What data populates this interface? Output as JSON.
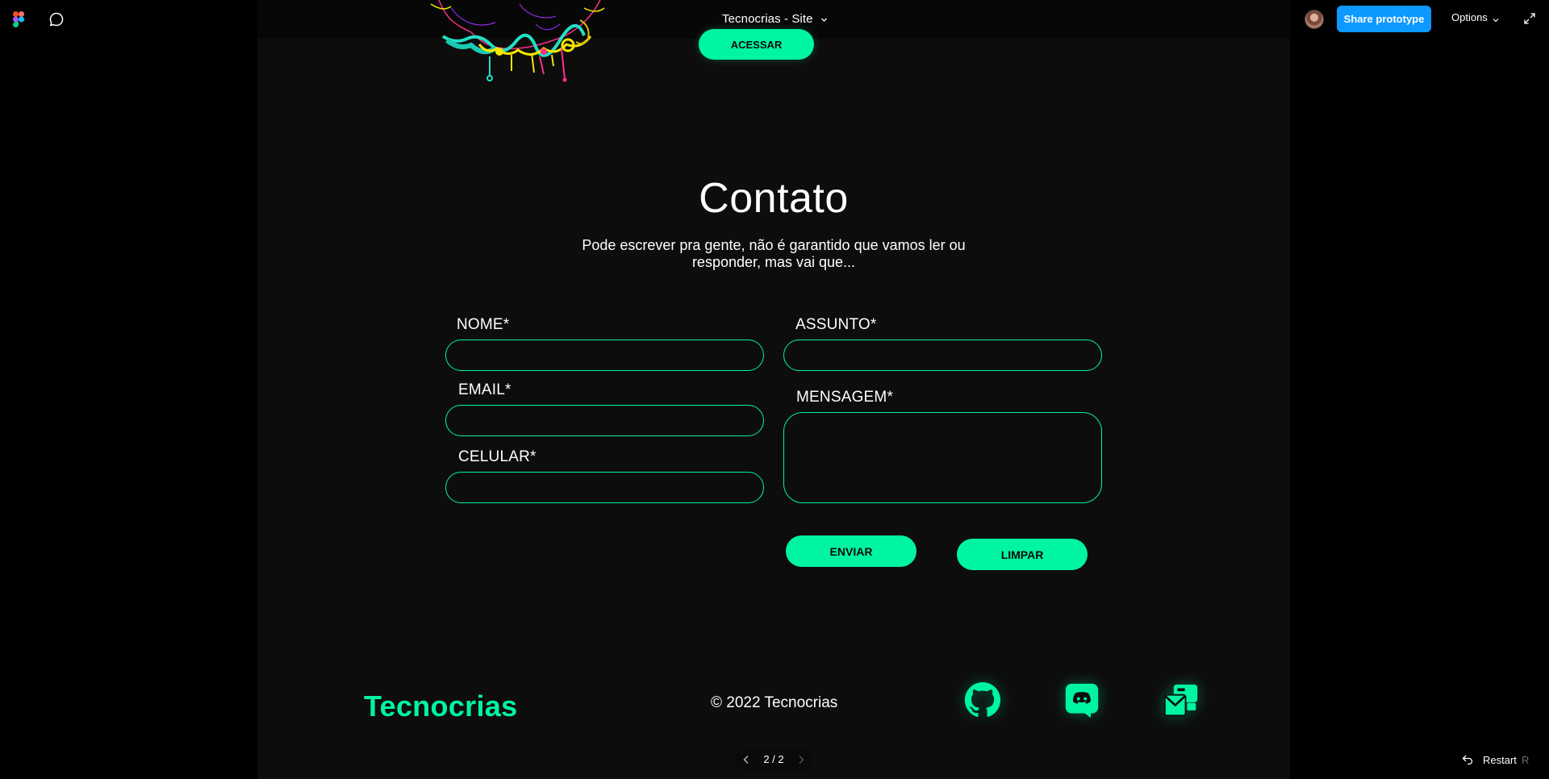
{
  "toolbar": {
    "title": "Tecnocrias - Site",
    "share_label": "Share prototype",
    "options_label": "Options"
  },
  "hero": {
    "acessar_label": "ACESSAR"
  },
  "contact": {
    "title": "Contato",
    "subtitle": "Pode escrever pra gente, não é garantido que vamos ler ou responder, mas vai que...",
    "fields": {
      "nome": {
        "label": "NOME*",
        "value": ""
      },
      "email": {
        "label": "EMAIL*",
        "value": ""
      },
      "celular": {
        "label": "CELULAR*",
        "value": ""
      },
      "assunto": {
        "label": "ASSUNTO*",
        "value": ""
      },
      "mensagem": {
        "label": "MENSAGEM*",
        "value": ""
      }
    },
    "send_label": "ENVIAR",
    "clear_label": "LIMPAR"
  },
  "footer": {
    "brand": "Tecnocrias",
    "copyright": "© 2022 Tecnocrias",
    "social_icons": [
      "github-icon",
      "discord-icon",
      "mail-icon"
    ]
  },
  "pager": {
    "text": "2 / 2"
  },
  "restart": {
    "label": "Restart",
    "shortcut": "R"
  },
  "colors": {
    "accent": "#00f5a0",
    "background": "#0d0d0d",
    "share_blue": "#0d99ff"
  }
}
